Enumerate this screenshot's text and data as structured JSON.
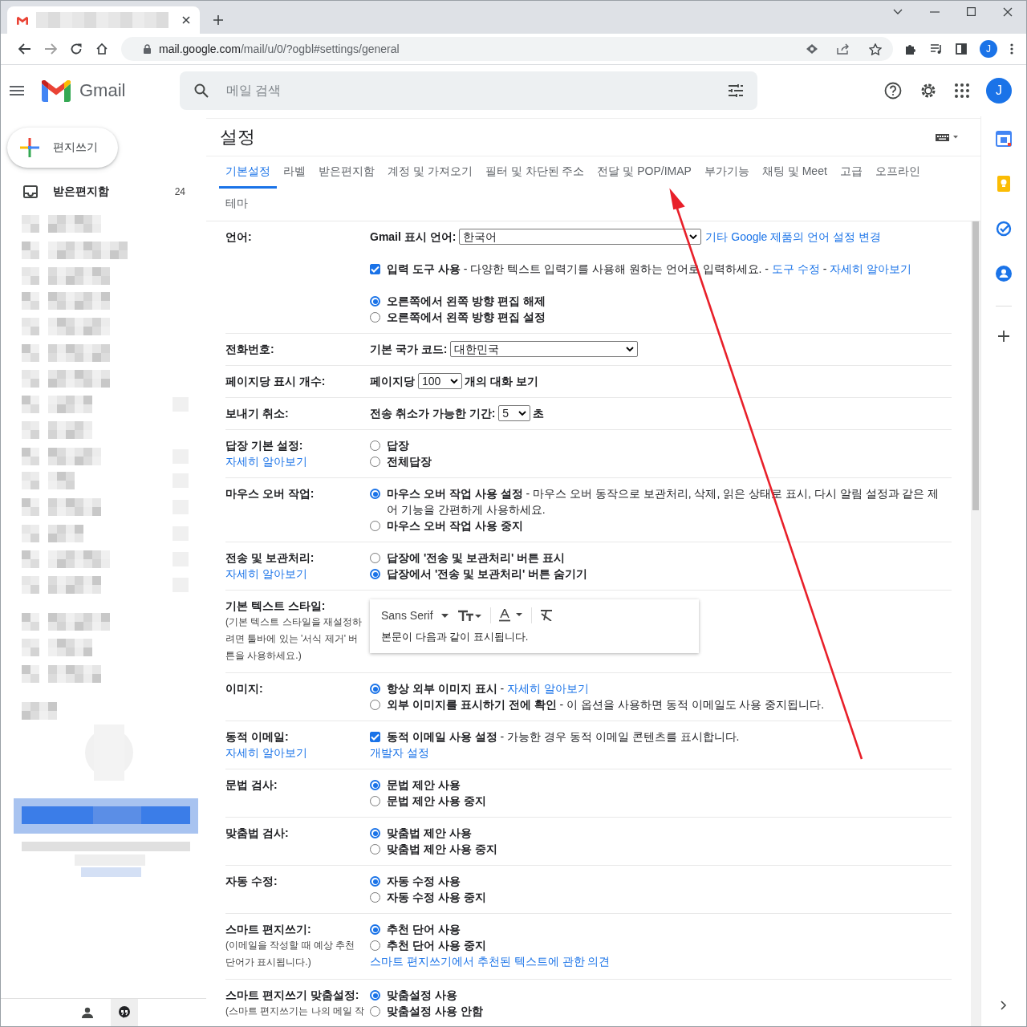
{
  "browser": {
    "url_domain": "mail.google.com",
    "url_path": "/mail/u/0/?ogbl#settings/general",
    "profile_initial": "J"
  },
  "header": {
    "app_name": "Gmail",
    "search_placeholder": "메일 검색",
    "avatar_initial": "J"
  },
  "sidebar": {
    "compose": "편지쓰기",
    "items": [
      {
        "label": "받은편지함",
        "count": "24"
      }
    ]
  },
  "settings": {
    "title": "설정",
    "tabs": [
      {
        "label": "기본설정",
        "selected": true
      },
      {
        "label": "라벨",
        "selected": false
      },
      {
        "label": "받은편지함",
        "selected": false
      },
      {
        "label": "계정 및 가져오기",
        "selected": false
      },
      {
        "label": "필터 및 차단된 주소",
        "selected": false
      },
      {
        "label": "전달 및 POP/IMAP",
        "selected": false
      },
      {
        "label": "부가기능",
        "selected": false
      },
      {
        "label": "채팅 및 Meet",
        "selected": false
      },
      {
        "label": "고급",
        "selected": false
      },
      {
        "label": "오프라인",
        "selected": false
      },
      {
        "label": "테마",
        "selected": false
      }
    ],
    "rows": [
      {
        "label": "언어:",
        "groups": [
          [
            {
              "kind": "select",
              "prefix": "Gmail 표시 언어:",
              "value": "한국어",
              "link": "기타 Google 제품의 언어 설정 변경"
            }
          ],
          [
            {
              "kind": "checkbox",
              "checked": true,
              "label": "입력 도구 사용",
              "parts": [
                {
                  "text": " - 다양한 텍스트 입력기를 사용해 원하는 언어로 입력하세요. - "
                },
                {
                  "link": "도구 수정"
                },
                {
                  "text": " - "
                },
                {
                  "link": "자세히 알아보기"
                }
              ]
            }
          ],
          [
            {
              "kind": "radio",
              "selected": true,
              "label": "오른쪽에서 왼쪽 방향 편집 해제"
            },
            {
              "kind": "radio",
              "selected": false,
              "label": "오른쪽에서 왼쪽 방향 편집 설정"
            }
          ]
        ]
      },
      {
        "label": "전화번호:",
        "groups": [
          [
            {
              "kind": "select",
              "prefix": "기본 국가 코드:",
              "value": "대한민국"
            }
          ]
        ]
      },
      {
        "label": "페이지당 표시 개수:",
        "groups": [
          [
            {
              "kind": "select",
              "prefix": "페이지당",
              "value": "100",
              "suffix": "개의 대화 보기"
            }
          ]
        ]
      },
      {
        "label": "보내기 취소:",
        "groups": [
          [
            {
              "kind": "select",
              "prefix": "전송 취소가 가능한 기간:",
              "value": "5",
              "suffix": "초"
            }
          ]
        ]
      },
      {
        "label": "답장 기본 설정:",
        "link": "자세히 알아보기",
        "groups": [
          [
            {
              "kind": "radio",
              "selected": false,
              "label": "답장"
            },
            {
              "kind": "radio",
              "selected": false,
              "label": "전체답장"
            }
          ]
        ]
      },
      {
        "label": "마우스 오버 작업:",
        "groups": [
          [
            {
              "kind": "radio",
              "selected": true,
              "label": "마우스 오버 작업 사용 설정",
              "parts": [
                {
                  "text": " - 마우스 오버 동작으로 보관처리, 삭제, 읽은 상태로 표시, 다시 알림 설정과 같은 제어 기능을 간편하게 사용하세요."
                }
              ]
            },
            {
              "kind": "radio",
              "selected": false,
              "label": "마우스 오버 작업 사용 중지"
            }
          ]
        ]
      },
      {
        "label": "전송 및 보관처리:",
        "link": "자세히 알아보기",
        "groups": [
          [
            {
              "kind": "radio",
              "selected": false,
              "label": "답장에 '전송 및 보관처리' 버튼 표시"
            },
            {
              "kind": "radio",
              "selected": true,
              "label": "답장에서 '전송 및 보관처리' 버튼 숨기기"
            }
          ]
        ]
      },
      {
        "label": "기본 텍스트 스타일:",
        "note": "(기본 텍스트 스타일을 재설정하려면 툴바에 있는 '서식 제거' 버튼을 사용하세요.)",
        "groups": [
          [
            {
              "kind": "editor",
              "font": "Sans Serif",
              "preview": "본문이 다음과 같이 표시됩니다."
            }
          ]
        ]
      },
      {
        "label": "이미지:",
        "groups": [
          [
            {
              "kind": "radio",
              "selected": true,
              "label": "항상 외부 이미지 표시",
              "parts": [
                {
                  "text": " - "
                },
                {
                  "link": "자세히 알아보기"
                }
              ]
            },
            {
              "kind": "radio",
              "selected": false,
              "label": "외부 이미지를 표시하기 전에 확인",
              "parts": [
                {
                  "text": " - 이 옵션을 사용하면 동적 이메일도 사용 중지됩니다."
                }
              ]
            }
          ]
        ]
      },
      {
        "label": "동적 이메일:",
        "link": "자세히 알아보기",
        "groups": [
          [
            {
              "kind": "checkbox",
              "checked": true,
              "label": "동적 이메일 사용 설정",
              "parts": [
                {
                  "text": " - 가능한 경우 동적 이메일 콘텐츠를 표시합니다."
                }
              ]
            },
            {
              "kind": "link",
              "text": "개발자 설정"
            }
          ]
        ]
      },
      {
        "label": "문법 검사:",
        "groups": [
          [
            {
              "kind": "radio",
              "selected": true,
              "label": "문법 제안 사용"
            },
            {
              "kind": "radio",
              "selected": false,
              "label": "문법 제안 사용 중지"
            }
          ]
        ]
      },
      {
        "label": "맞춤법 검사:",
        "groups": [
          [
            {
              "kind": "radio",
              "selected": true,
              "label": "맞춤법 제안 사용"
            },
            {
              "kind": "radio",
              "selected": false,
              "label": "맞춤법 제안 사용 중지"
            }
          ]
        ]
      },
      {
        "label": "자동 수정:",
        "groups": [
          [
            {
              "kind": "radio",
              "selected": true,
              "label": "자동 수정 사용"
            },
            {
              "kind": "radio",
              "selected": false,
              "label": "자동 수정 사용 중지"
            }
          ]
        ]
      },
      {
        "label": "스마트 편지쓰기:",
        "note": "(이메일을 작성할 때 예상 추천 단어가 표시됩니다.)",
        "groups": [
          [
            {
              "kind": "radio",
              "selected": true,
              "label": "추천 단어 사용"
            },
            {
              "kind": "radio",
              "selected": false,
              "label": "추천 단어 사용 중지"
            },
            {
              "kind": "link",
              "text": "스마트 편지쓰기에서 추천된 텍스트에 관한 의견"
            }
          ]
        ]
      },
      {
        "label": "스마트 편지쓰기 맞춤설정:",
        "note": "(스마트 편지쓰기는 나의 메일 작",
        "groups": [
          [
            {
              "kind": "radio",
              "selected": true,
              "label": "맞춤설정 사용"
            },
            {
              "kind": "radio",
              "selected": false,
              "label": "맞춤설정 사용 안함"
            }
          ]
        ]
      }
    ]
  }
}
